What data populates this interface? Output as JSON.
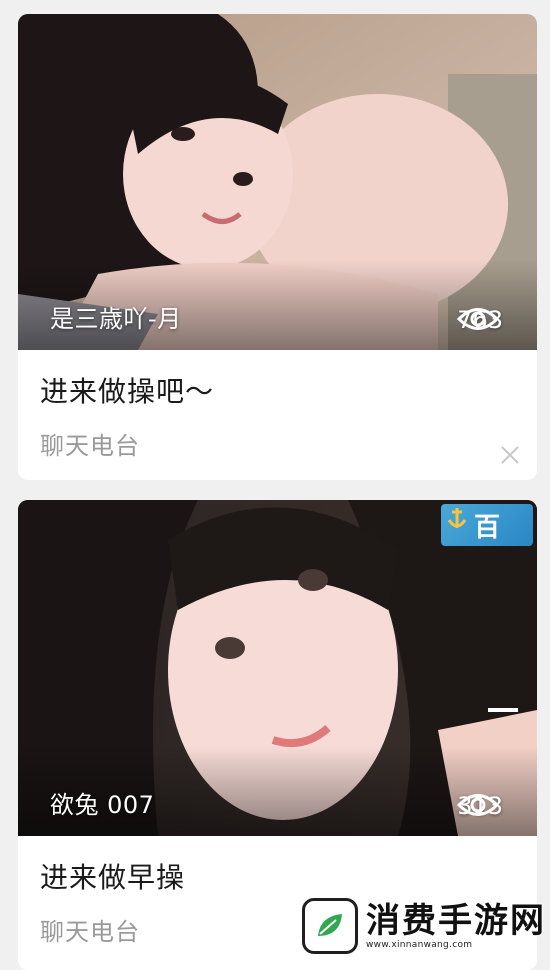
{
  "feed": [
    {
      "host": "是三歳吖-月",
      "views": "763",
      "title": "进来做操吧～",
      "category": "聊天电台"
    },
    {
      "host": "欲兔 007",
      "views": "313",
      "title": "进来做早操",
      "category": "聊天电台",
      "badge": "百"
    }
  ],
  "watermark": {
    "name": "消费手游网",
    "url": "www.xinnanwang.com"
  },
  "colors": {
    "card": "#ffffff",
    "background": "#f0f0f0",
    "title": "#1a1a1a",
    "category": "#9a9a9a",
    "badge": "#2b86c5"
  },
  "icons": [
    "eye-icon",
    "close-icon",
    "app-badge-icon",
    "site-logo-icon"
  ]
}
